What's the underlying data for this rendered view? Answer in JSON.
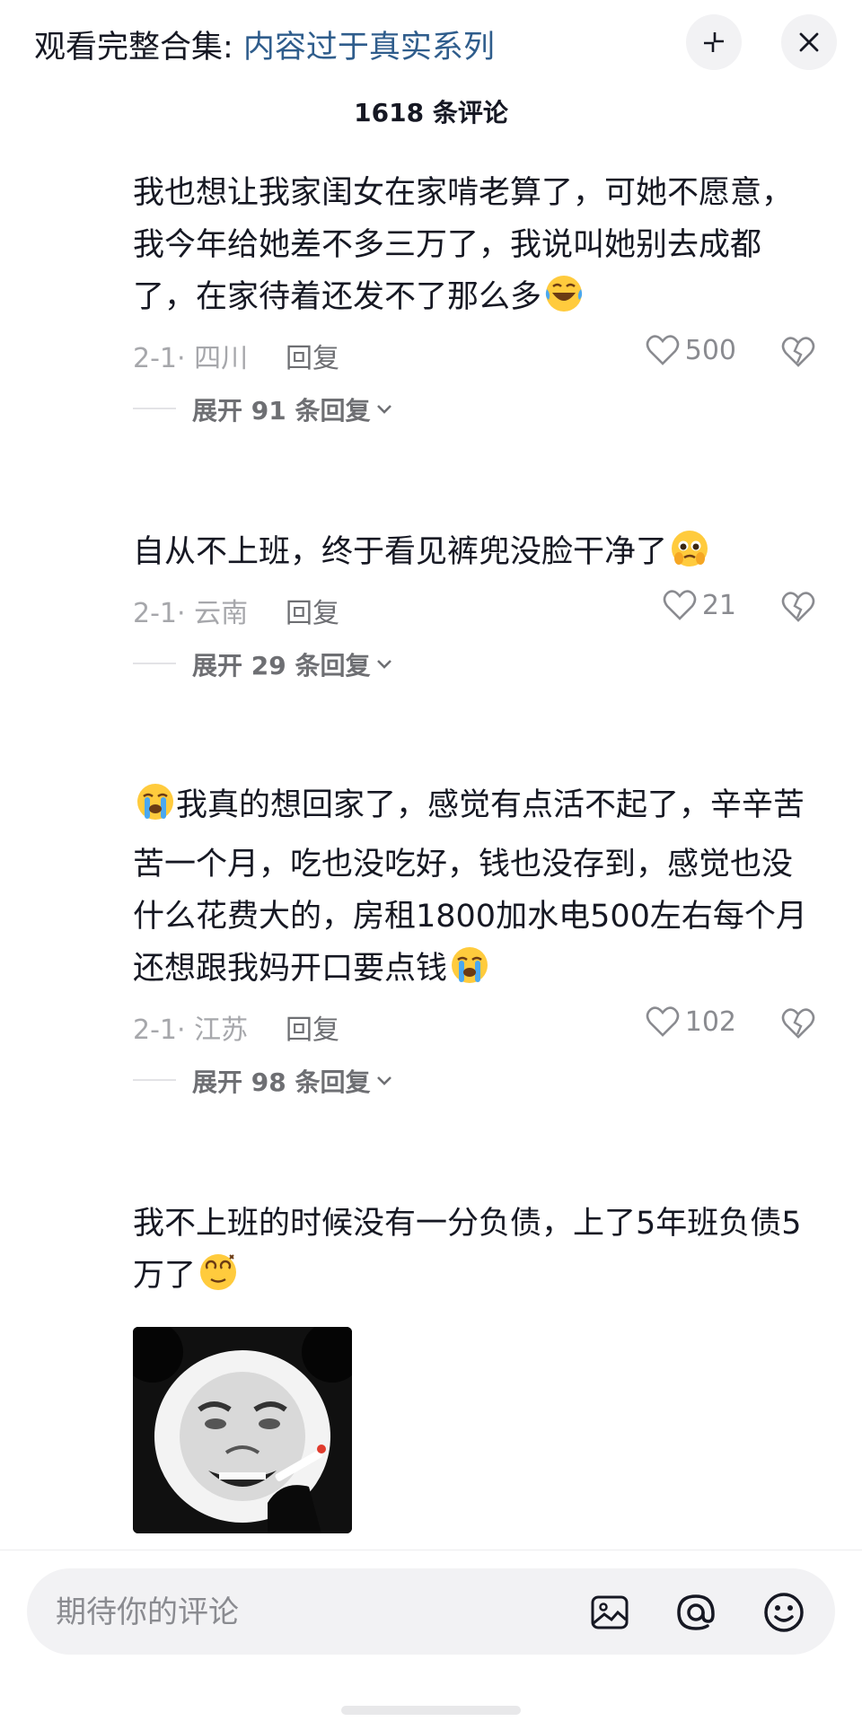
{
  "header": {
    "prefix": "观看完整合集: ",
    "collection": "内容过于真实系列",
    "comment_count": "1618 条评论"
  },
  "comments": [
    {
      "text": "我也想让我家闺女在家啃老算了，可她不愿意，我今年给她差不多三万了，我说叫她别去成都了，在家待着还发不了那么多",
      "emoji": "crying-laughing-emoji",
      "date": "2-1· 四川",
      "reply": "回复",
      "likes": "500",
      "expand": "展开 91 条回复"
    },
    {
      "text": "自从不上班，终于看见裤兜没脸干净了",
      "emoji": "pleading-emoji",
      "date": "2-1· 云南",
      "reply": "回复",
      "likes": "21",
      "expand": "展开 29 条回复"
    },
    {
      "text": "我真的想回家了，感觉有点活不起了，辛辛苦苦一个月，吃也没吃好，钱也没存到，感觉也没什么花费大的，房租1800加水电500左右每个月还想跟我妈开口要点钱",
      "emoji": "loudly-crying-emoji",
      "date": "2-1· 江苏",
      "reply": "回复",
      "likes": "102",
      "expand": "展开 98 条回复"
    },
    {
      "text": "我不上班的时候没有一分负债，上了5年班负债5万了",
      "emoji": "dizzy-face-emoji"
    }
  ],
  "input": {
    "placeholder": "期待你的评论"
  },
  "icons": [
    "collapse-icon",
    "close-icon",
    "heart-icon",
    "broken-heart-icon",
    "chevron-down-icon",
    "image-icon",
    "at-icon",
    "smiley-icon"
  ]
}
